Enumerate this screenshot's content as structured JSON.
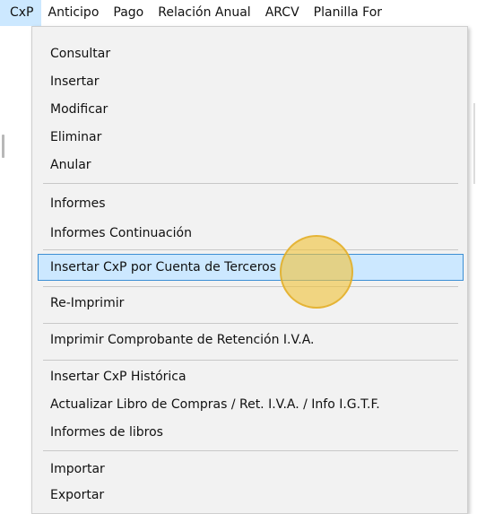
{
  "menubar": {
    "items": [
      "CxP",
      "Anticipo",
      "Pago",
      "Relación Anual",
      "ARCV",
      "Planilla For"
    ]
  },
  "menu": {
    "items": [
      "Consultar",
      "Insertar",
      "Modificar",
      "Eliminar",
      "Anular",
      "Informes",
      "Informes Continuación",
      "Insertar CxP por Cuenta de Terceros",
      "Re-Imprimir",
      "Imprimir Comprobante de Retención I.V.A.",
      "Insertar CxP Histórica",
      "Actualizar Libro de Compras / Ret. I.V.A. / Info I.G.T.F.",
      "Informes de libros",
      "Importar",
      "Exportar"
    ],
    "highlighted": "Insertar CxP por Cuenta de Terceros"
  },
  "colors": {
    "highlight_bg": "#cce8ff",
    "highlight_border": "#3d8fd4",
    "menu_bg": "#f2f2f2",
    "cursor": "#f0c43c"
  }
}
